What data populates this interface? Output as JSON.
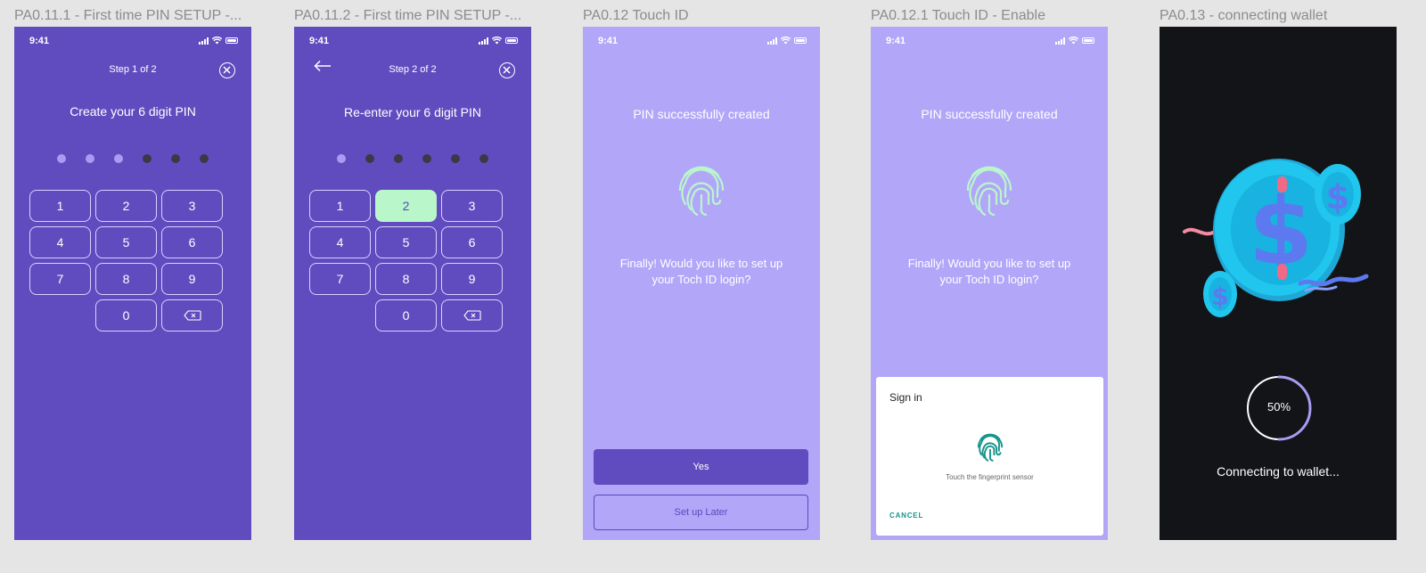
{
  "frames": [
    {
      "title": "PA0.11.1 - First time PIN SETUP -...",
      "time": "9:41",
      "step": "Step 1 of 2",
      "heading": "Create your 6 digit PIN",
      "keys": [
        "1",
        "2",
        "3",
        "4",
        "5",
        "6",
        "7",
        "8",
        "9",
        "",
        "0",
        "backspace"
      ]
    },
    {
      "title": "PA0.11.2 - First time PIN SETUP -...",
      "time": "9:41",
      "step": "Step 2 of 2",
      "heading": "Re-enter your 6 digit PIN",
      "active_key": "2",
      "keys": [
        "1",
        "2",
        "3",
        "4",
        "5",
        "6",
        "7",
        "8",
        "9",
        "",
        "0",
        "backspace"
      ]
    },
    {
      "title": "PA0.12 Touch ID",
      "time": "9:41",
      "heading": "PIN successfully created",
      "body_line1": "Finally! Would you like to set up",
      "body_line2": "your Toch ID login?",
      "primary_button": "Yes",
      "secondary_button": "Set up Later"
    },
    {
      "title": "PA0.12.1 Touch ID - Enable",
      "time": "9:41",
      "heading": "PIN successfully created",
      "body_line1": "Finally! Would you like to set up",
      "body_line2": "your Toch ID login?",
      "sheet_title": "Sign in",
      "sheet_hint": "Touch the fingerprint sensor",
      "sheet_cancel": "CANCEL"
    },
    {
      "title": "PA0.13 - connecting wallet",
      "progress_label": "50%",
      "progress_value": 0.5,
      "status": "Connecting to wallet..."
    }
  ],
  "colors": {
    "dark_purple": "#614cbf",
    "light_purple": "#b2a6f9",
    "black": "#121417",
    "mint": "#b9f7cb",
    "teal": "#16958b"
  },
  "icons": [
    "close-circle-icon",
    "back-arrow-icon",
    "backspace-icon",
    "fingerprint-icon",
    "dollar-coin-illustration",
    "signal-icon",
    "wifi-icon",
    "battery-icon"
  ]
}
